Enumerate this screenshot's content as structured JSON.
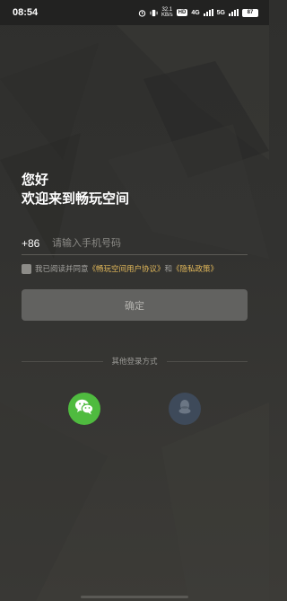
{
  "status_bar": {
    "time": "08:54",
    "speed_value": "32.1",
    "speed_unit": "KB/s",
    "network_badge": "HD",
    "network_type_1": "4G",
    "network_type_2": "5G",
    "battery": "87",
    "icons": [
      "alarm-icon",
      "vibrate-icon",
      "signal-icon",
      "battery-icon"
    ]
  },
  "greeting": {
    "line1": "您好",
    "line2": "欢迎来到畅玩空间"
  },
  "phone": {
    "country_code": "+86",
    "placeholder": "请输入手机号码",
    "value": ""
  },
  "agreement": {
    "checked": false,
    "prefix": "我已阅读并同意",
    "link1": "《畅玩空间用户协议》",
    "conjunction": "和",
    "link2": "《隐私政策》"
  },
  "confirm_label": "确定",
  "other_login": {
    "label": "其他登录方式",
    "methods": [
      {
        "name": "wechat",
        "icon": "wechat-icon",
        "color": "#4fbb3f"
      },
      {
        "name": "qq",
        "icon": "qq-icon",
        "color": "#3e4a5a"
      }
    ]
  },
  "colors": {
    "background": "#31312f",
    "link": "#e3b95a",
    "button": "#626260"
  }
}
